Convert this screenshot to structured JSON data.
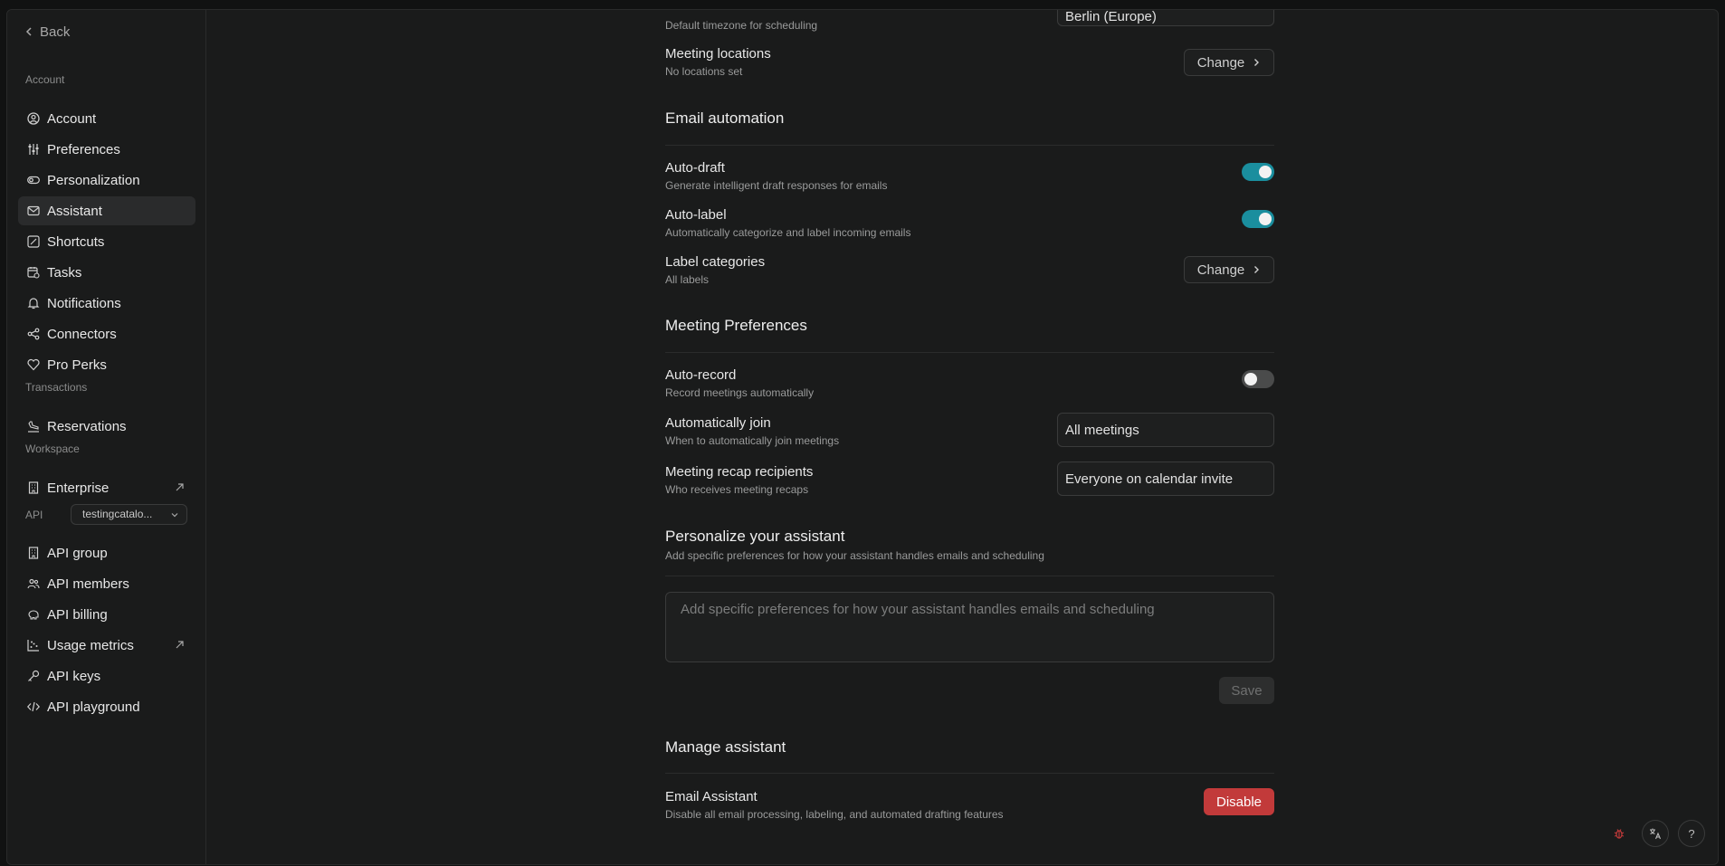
{
  "sidebar": {
    "back_label": "Back",
    "sections": {
      "account": "Account",
      "transactions": "Transactions",
      "workspace": "Workspace",
      "api": "API"
    },
    "items": [
      {
        "label": "Account",
        "icon": "user-circle-icon"
      },
      {
        "label": "Preferences",
        "icon": "sliders-icon"
      },
      {
        "label": "Personalization",
        "icon": "toggle-icon"
      },
      {
        "label": "Assistant",
        "icon": "mail-icon",
        "active": true
      },
      {
        "label": "Shortcuts",
        "icon": "edit-square-icon"
      },
      {
        "label": "Tasks",
        "icon": "calendar-clock-icon"
      },
      {
        "label": "Notifications",
        "icon": "bell-icon"
      },
      {
        "label": "Connectors",
        "icon": "share-nodes-icon"
      },
      {
        "label": "Pro Perks",
        "icon": "heart-gem-icon"
      },
      {
        "label": "Reservations",
        "icon": "plane-landing-icon"
      },
      {
        "label": "Enterprise",
        "icon": "building-icon"
      },
      {
        "label": "API group",
        "icon": "building-icon"
      },
      {
        "label": "API members",
        "icon": "users-icon"
      },
      {
        "label": "API billing",
        "icon": "piggy-bank-icon"
      },
      {
        "label": "Usage metrics",
        "icon": "chart-scatter-icon"
      },
      {
        "label": "API keys",
        "icon": "key-icon"
      },
      {
        "label": "API playground",
        "icon": "code-icon"
      }
    ],
    "api_selector": "testingcatalo..."
  },
  "main": {
    "timezone": {
      "desc": "Default timezone for scheduling",
      "value": "Berlin (Europe)"
    },
    "meeting_locations": {
      "title": "Meeting locations",
      "desc": "No locations set",
      "button": "Change"
    },
    "email_automation": {
      "title": "Email automation",
      "auto_draft": {
        "title": "Auto-draft",
        "desc": "Generate intelligent draft responses for emails",
        "on": true
      },
      "auto_label": {
        "title": "Auto-label",
        "desc": "Automatically categorize and label incoming emails",
        "on": true
      },
      "label_categories": {
        "title": "Label categories",
        "desc": "All labels",
        "button": "Change"
      }
    },
    "meeting_prefs": {
      "title": "Meeting Preferences",
      "auto_record": {
        "title": "Auto-record",
        "desc": "Record meetings automatically",
        "on": false
      },
      "auto_join": {
        "title": "Automatically join",
        "desc": "When to automatically join meetings",
        "value": "All meetings"
      },
      "recap": {
        "title": "Meeting recap recipients",
        "desc": "Who receives meeting recaps",
        "value": "Everyone on calendar invite"
      }
    },
    "personalize": {
      "title": "Personalize your assistant",
      "sub": "Add specific preferences for how your assistant handles emails and scheduling",
      "placeholder": "Add specific preferences for how your assistant handles emails and scheduling",
      "save": "Save"
    },
    "manage": {
      "title": "Manage assistant",
      "email_assistant": {
        "title": "Email Assistant",
        "desc": "Disable all email processing, labeling, and automated drafting features",
        "button": "Disable"
      }
    }
  },
  "corner": {
    "help": "?"
  },
  "colors": {
    "accent": "#1a8e9e",
    "danger": "#c23a3a",
    "background": "#1a1b1b"
  }
}
